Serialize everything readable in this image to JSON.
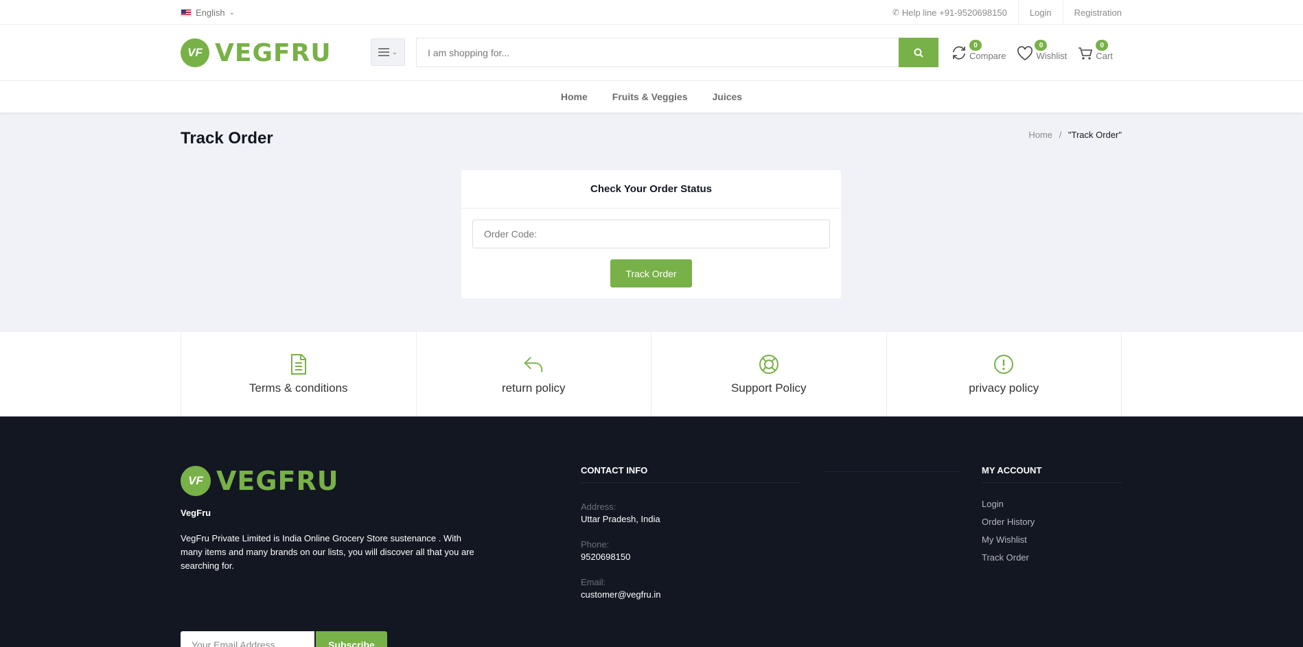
{
  "topbar": {
    "language": "English",
    "helpline": "Help line +91-9520698150",
    "login": "Login",
    "registration": "Registration"
  },
  "header": {
    "logo_mark": "VF",
    "logo_text": "VEGFRU",
    "search_placeholder": "I am shopping for...",
    "compare": {
      "label": "Compare",
      "count": "0"
    },
    "wishlist": {
      "label": "Wishlist",
      "count": "0"
    },
    "cart": {
      "label": "Cart",
      "count": "0"
    }
  },
  "nav": {
    "items": [
      "Home",
      "Fruits & Veggies",
      "Juices"
    ]
  },
  "main": {
    "page_title": "Track Order",
    "breadcrumb_home": "Home",
    "breadcrumb_sep": "/",
    "breadcrumb_current": "\"Track Order\"",
    "card_title": "Check Your Order Status",
    "order_code_placeholder": "Order Code:",
    "track_button": "Track Order"
  },
  "policies": [
    {
      "label": "Terms & conditions",
      "icon": "document-icon"
    },
    {
      "label": "return policy",
      "icon": "reply-arrow-icon"
    },
    {
      "label": "Support Policy",
      "icon": "lifebuoy-icon"
    },
    {
      "label": "privacy policy",
      "icon": "exclamation-circle-icon"
    }
  ],
  "footer": {
    "logo_text": "VEGFRU",
    "company_name": "VegFru",
    "description": "VegFru Private Limited is India Online Grocery Store sustenance . With many items and many brands on our lists, you will discover all that you are searching for.",
    "email_placeholder": "Your Email Address",
    "subscribe": "Subscribe",
    "contact": {
      "title": "CONTACT INFO",
      "address_label": "Address:",
      "address": "Uttar Pradesh, India",
      "phone_label": "Phone:",
      "phone": "9520698150",
      "email_label": "Email:",
      "email": "customer@vegfru.in"
    },
    "account": {
      "title": "MY ACCOUNT",
      "links": [
        "Login",
        "Order History",
        "My Wishlist",
        "Track Order"
      ]
    }
  },
  "colors": {
    "accent": "#78b147",
    "footer_bg": "#131722",
    "main_bg": "#f1f2f7"
  }
}
